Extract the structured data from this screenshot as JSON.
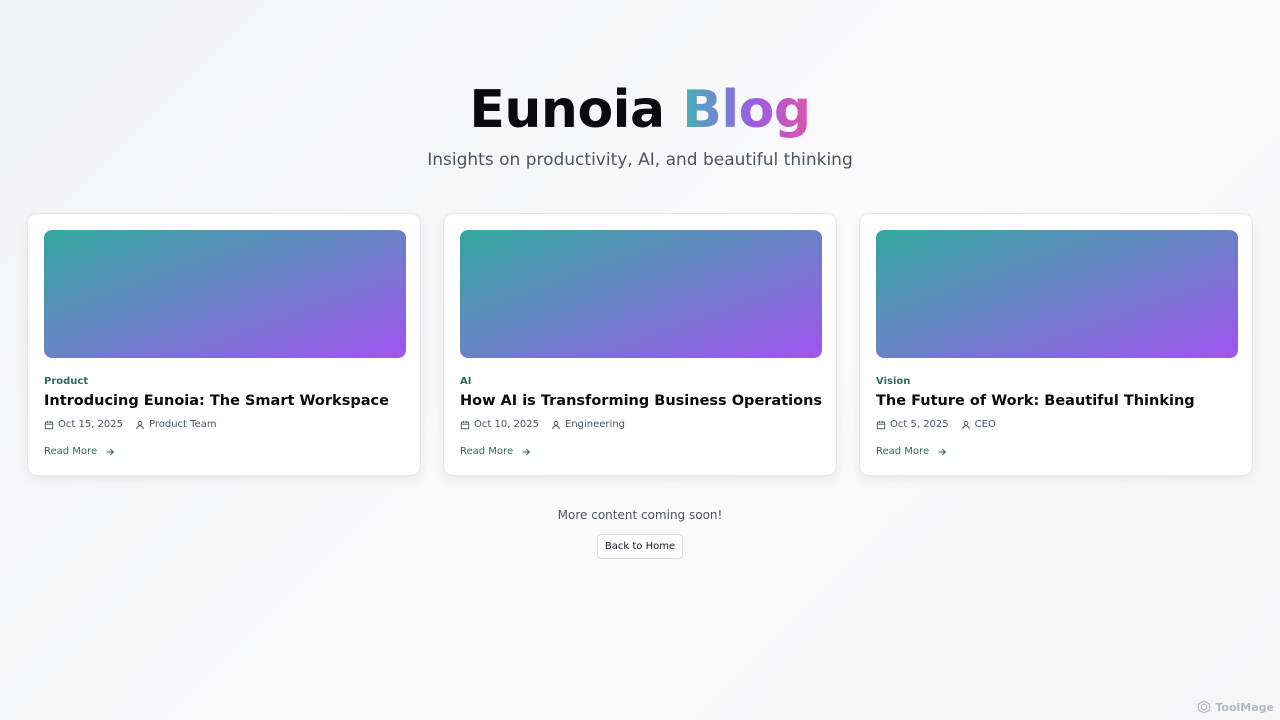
{
  "header": {
    "title_part1": "Eunoia",
    "title_part2": "Blog",
    "subtitle": "Insights on productivity, AI, and beautiful thinking"
  },
  "posts": [
    {
      "category": "Product",
      "title": "Introducing Eunoia: The Smart Workspace",
      "date": "Oct 15, 2025",
      "author": "Product Team",
      "cta": "Read More"
    },
    {
      "category": "AI",
      "title": "How AI is Transforming Business Operations",
      "date": "Oct 10, 2025",
      "author": "Engineering",
      "cta": "Read More"
    },
    {
      "category": "Vision",
      "title": "The Future of Work: Beautiful Thinking",
      "date": "Oct 5, 2025",
      "author": "CEO",
      "cta": "Read More"
    }
  ],
  "footer": {
    "message": "More content coming soon!",
    "back_button": "Back to Home"
  },
  "watermark": "ToolMage",
  "colors": {
    "accent": "#2d6b63",
    "gradient_start": "#34a8a0",
    "gradient_end": "#a154f0",
    "title_gradient": [
      "#43b3b6",
      "#9b5de5",
      "#e052a9"
    ]
  }
}
